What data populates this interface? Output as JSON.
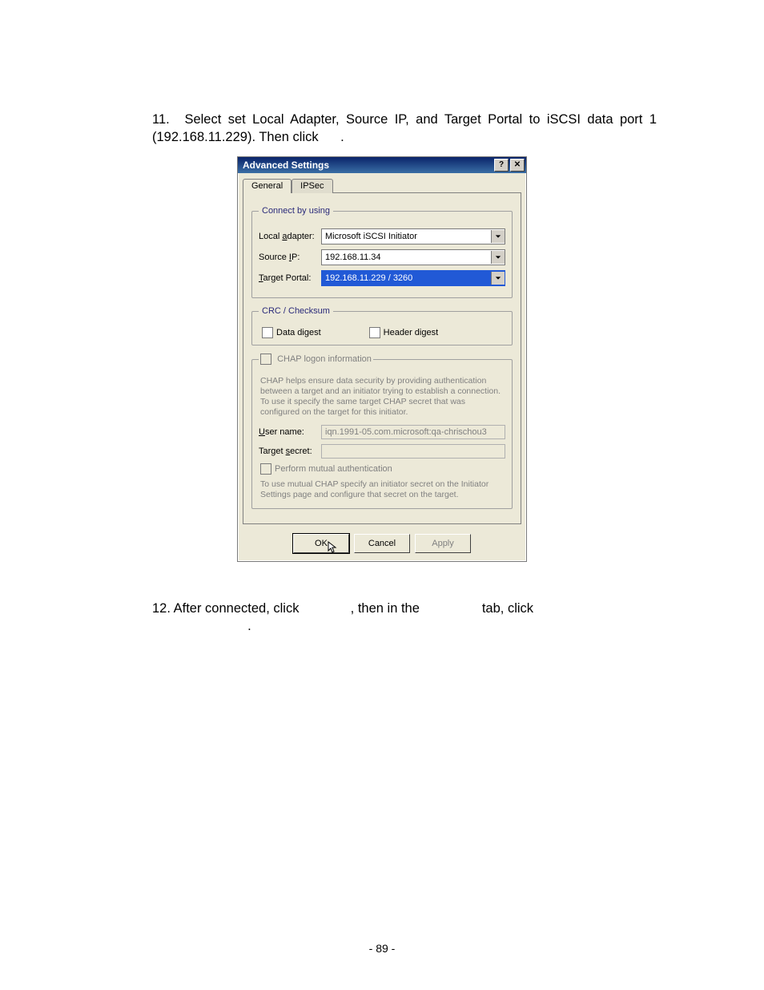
{
  "instruction1": {
    "number": "11.",
    "text_a": "Select set Local Adapter, Source IP, and Target Portal to iSCSI data port 1 (192.168.11.229). Then click ",
    "text_b": "."
  },
  "instruction2": {
    "number": "12.",
    "text_a": "After  connected,  click  ",
    "text_b": ",  then  in  the  ",
    "text_c": "  tab,  click ",
    "text_d": "."
  },
  "dialog": {
    "title": "Advanced Settings",
    "help_btn": "?",
    "close_btn": "✕",
    "tabs": {
      "general": "General",
      "ipsec": "IPSec"
    },
    "connect_legend": "Connect by using",
    "local_adapter_label": "Local adapter:",
    "local_adapter_u": "a",
    "local_adapter_value": "Microsoft iSCSI Initiator",
    "source_ip_label": "Source IP:",
    "source_ip_u": "I",
    "source_ip_value": "192.168.11.34",
    "target_portal_label": "Target Portal:",
    "target_portal_u": "T",
    "target_portal_value": "192.168.11.229 / 3260",
    "crc_legend": "CRC / Checksum",
    "data_digest": "Data digest",
    "data_digest_u": "D",
    "header_digest": "Header digest",
    "header_digest_u": "H",
    "chap_legend": "CHAP logon information",
    "chap_legend_u": "C",
    "chap_text": "CHAP helps ensure data security by providing authentication between a target and an initiator trying to establish a connection. To use it specify the same target CHAP secret that was configured on the target for this initiator.",
    "user_name_label": "User name:",
    "user_name_u": "U",
    "user_name_value": "iqn.1991-05.com.microsoft:qa-chrischou3",
    "target_secret_label": "Target secret:",
    "target_secret_u": "s",
    "target_secret_value": "",
    "perform_mutual": "Perform mutual authentication",
    "perform_mutual_u": "P",
    "mutual_note": "To use mutual CHAP specify an initiator secret on the Initiator Settings page and configure that secret on the target.",
    "ok_btn": "OK",
    "cancel_btn": "Cancel",
    "apply_btn": "Apply"
  },
  "page_number": "- 89 -"
}
